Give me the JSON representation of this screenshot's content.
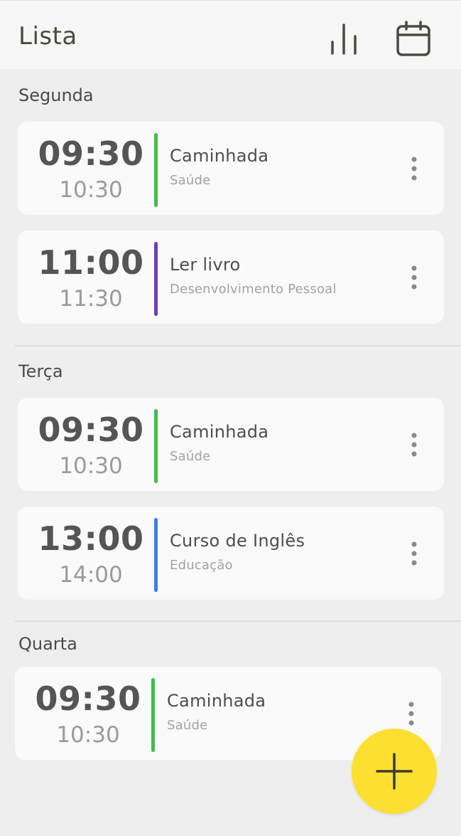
{
  "header": {
    "title": "Lista",
    "stats_icon": "bar-chart-icon",
    "calendar_icon": "calendar-icon"
  },
  "days": [
    {
      "name": "Segunda",
      "events": [
        {
          "start": "09:30",
          "end": "10:30",
          "title": "Caminhada",
          "category": "Saúde",
          "color": "#3fbd4f"
        },
        {
          "start": "11:00",
          "end": "11:30",
          "title": "Ler livro",
          "category": "Desenvolvimento Pessoal",
          "color": "#6a3fb5"
        }
      ]
    },
    {
      "name": "Terça",
      "events": [
        {
          "start": "09:30",
          "end": "10:30",
          "title": "Caminhada",
          "category": "Saúde",
          "color": "#3fbd4f"
        },
        {
          "start": "13:00",
          "end": "14:00",
          "title": "Curso de Inglês",
          "category": "Educação",
          "color": "#3d7fe0"
        }
      ]
    },
    {
      "name": "Quarta",
      "events": [
        {
          "start": "09:30",
          "end": "10:30",
          "title": "Caminhada",
          "category": "Saúde",
          "color": "#3fbd4f"
        }
      ]
    }
  ],
  "fab": {
    "icon": "plus-icon",
    "color": "#fddf32"
  },
  "more_icon": "more-vertical-icon"
}
